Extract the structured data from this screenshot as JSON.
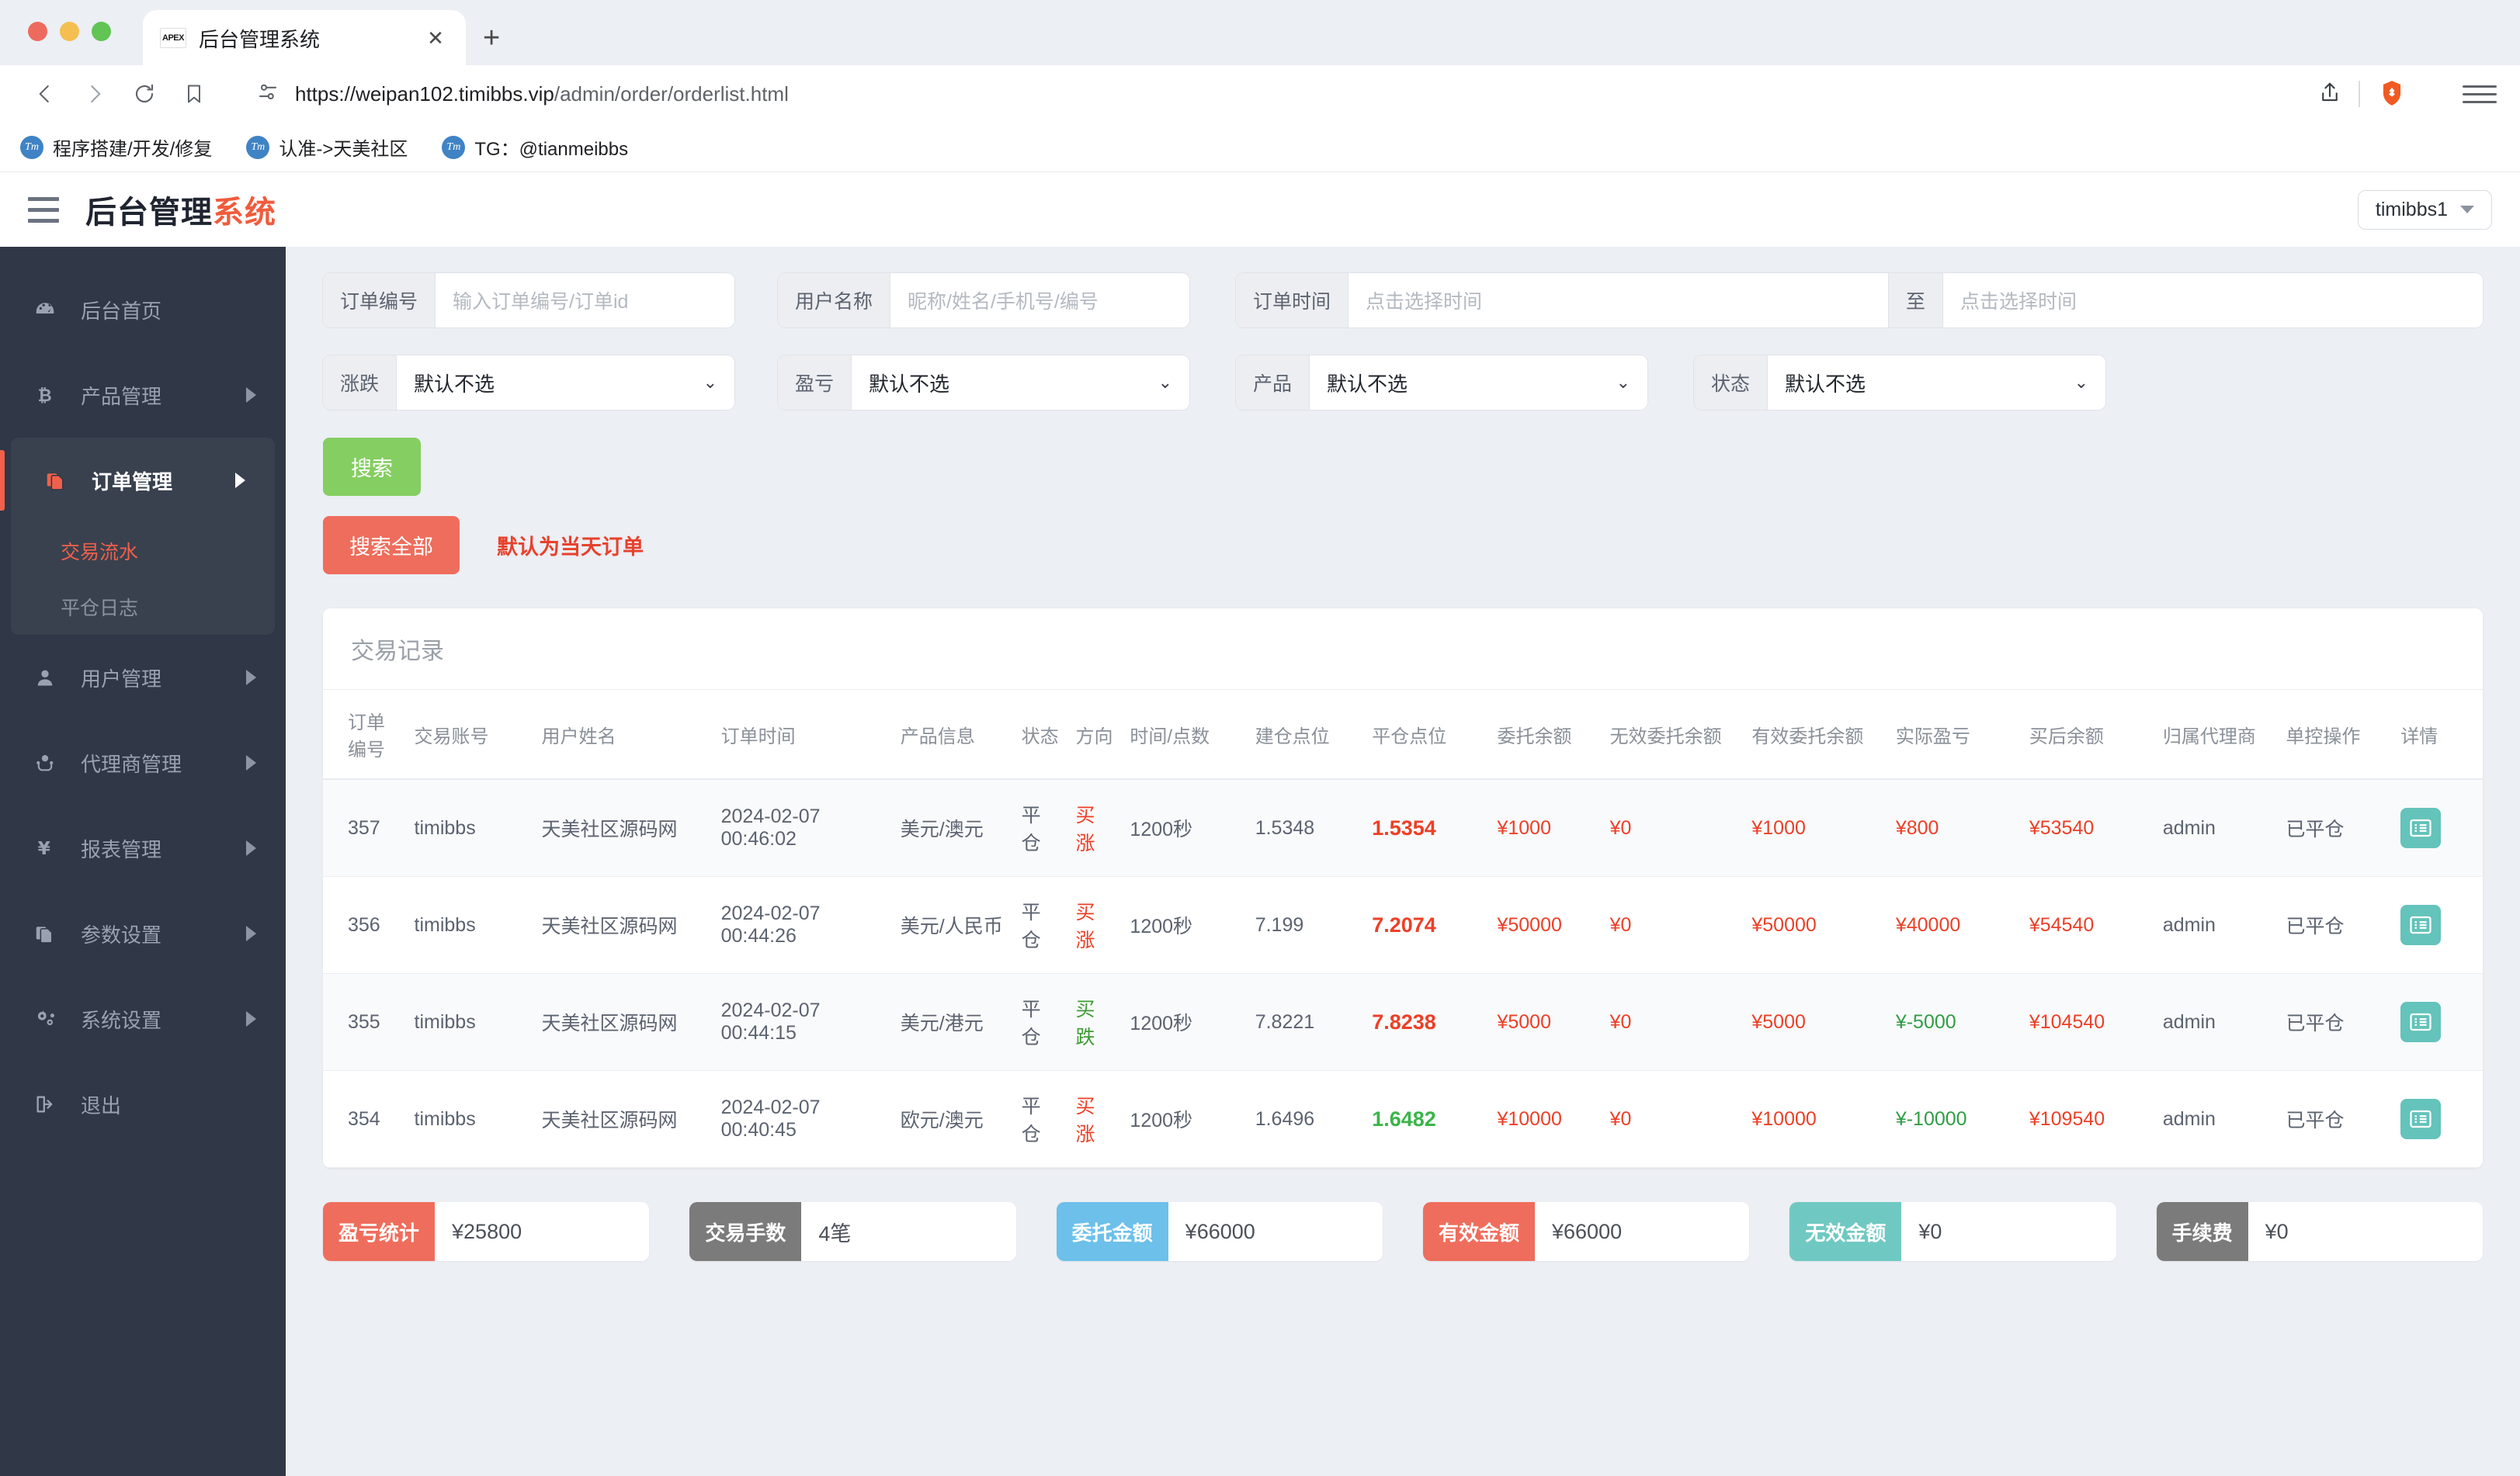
{
  "browser": {
    "tab_title": "后台管理系统",
    "tab_favicon_text": "APEX",
    "tab_close": "✕",
    "new_tab": "+",
    "url_secure": "https://weipan102.timibbs.vip",
    "url_path": "/admin/order/orderlist.html",
    "bookmarks": [
      {
        "icon": "Tm",
        "label": "程序搭建/开发/修复"
      },
      {
        "icon": "Tm",
        "label": "认准->天美社区"
      },
      {
        "icon": "Tm",
        "label": "TG：@tianmeibbs"
      }
    ]
  },
  "header": {
    "brand_main": "后台管理",
    "brand_accent": "系统",
    "user": "timibbs1"
  },
  "sidebar": {
    "items": [
      {
        "label": "后台首页",
        "icon": "dashboard-icon",
        "arrow": false
      },
      {
        "label": "产品管理",
        "icon": "bitcoin-icon",
        "arrow": true
      },
      {
        "label": "订单管理",
        "icon": "order-doc-icon",
        "arrow": true,
        "active": true,
        "children": [
          {
            "label": "交易流水",
            "selected": true
          },
          {
            "label": "平仓日志",
            "selected": false
          }
        ]
      },
      {
        "label": "用户管理",
        "icon": "user-icon",
        "arrow": true
      },
      {
        "label": "代理商管理",
        "icon": "agent-icon",
        "arrow": true
      },
      {
        "label": "报表管理",
        "icon": "yen-icon",
        "arrow": true
      },
      {
        "label": "参数设置",
        "icon": "params-doc-icon",
        "arrow": true
      },
      {
        "label": "系统设置",
        "icon": "gears-icon",
        "arrow": true
      },
      {
        "label": "退出",
        "icon": "logout-icon",
        "arrow": false
      }
    ]
  },
  "filters": {
    "order_no": {
      "label": "订单编号",
      "placeholder": "输入订单编号/订单id",
      "value": ""
    },
    "user_name": {
      "label": "用户名称",
      "placeholder": "昵称/姓名/手机号/编号",
      "value": ""
    },
    "order_time": {
      "label": "订单时间",
      "placeholder_from": "点击选择时间",
      "separator": "至",
      "placeholder_to": "点击选择时间"
    },
    "updown": {
      "label": "涨跌",
      "value": "默认不选"
    },
    "profit_loss": {
      "label": "盈亏",
      "value": "默认不选"
    },
    "product": {
      "label": "产品",
      "value": "默认不选"
    },
    "status": {
      "label": "状态",
      "value": "默认不选"
    },
    "search_button": "搜索",
    "search_all_button": "搜索全部",
    "note": "默认为当天订单"
  },
  "table": {
    "title": "交易记录",
    "columns": [
      "订单编号",
      "交易账号",
      "用户姓名",
      "订单时间",
      "产品信息",
      "状态",
      "方向",
      "时间/点数",
      "建仓点位",
      "平仓点位",
      "委托余额",
      "无效委托余额",
      "有效委托余额",
      "实际盈亏",
      "买后余额",
      "归属代理商",
      "单控操作",
      "详情"
    ],
    "rows": [
      {
        "order_no": "357",
        "account": "timibbs",
        "user_name": "天美社区源码网",
        "order_time": "2024-02-07 00:46:02",
        "product": "美元/澳元",
        "status": "平仓",
        "direction": "买涨",
        "direction_color": "red",
        "duration": "1200秒",
        "open_price": "1.5348",
        "close_price": "1.5354",
        "close_color": "red",
        "entrust": "¥1000",
        "invalid_entrust": "¥0",
        "valid_entrust": "¥1000",
        "real_pl": "¥800",
        "real_pl_color": "red",
        "balance_after": "¥53540",
        "agent": "admin",
        "single_control": "已平仓",
        "detail_icon": "detail-icon"
      },
      {
        "order_no": "356",
        "account": "timibbs",
        "user_name": "天美社区源码网",
        "order_time": "2024-02-07 00:44:26",
        "product": "美元/人民币",
        "status": "平仓",
        "direction": "买涨",
        "direction_color": "red",
        "duration": "1200秒",
        "open_price": "7.199",
        "close_price": "7.2074",
        "close_color": "red",
        "entrust": "¥50000",
        "invalid_entrust": "¥0",
        "valid_entrust": "¥50000",
        "real_pl": "¥40000",
        "real_pl_color": "red",
        "balance_after": "¥54540",
        "agent": "admin",
        "single_control": "已平仓",
        "detail_icon": "detail-icon"
      },
      {
        "order_no": "355",
        "account": "timibbs",
        "user_name": "天美社区源码网",
        "order_time": "2024-02-07 00:44:15",
        "product": "美元/港元",
        "status": "平仓",
        "direction": "买跌",
        "direction_color": "green",
        "duration": "1200秒",
        "open_price": "7.8221",
        "close_price": "7.8238",
        "close_color": "red",
        "entrust": "¥5000",
        "invalid_entrust": "¥0",
        "valid_entrust": "¥5000",
        "real_pl": "¥-5000",
        "real_pl_color": "green",
        "balance_after": "¥104540",
        "agent": "admin",
        "single_control": "已平仓",
        "detail_icon": "detail-icon"
      },
      {
        "order_no": "354",
        "account": "timibbs",
        "user_name": "天美社区源码网",
        "order_time": "2024-02-07 00:40:45",
        "product": "欧元/澳元",
        "status": "平仓",
        "direction": "买涨",
        "direction_color": "red",
        "duration": "1200秒",
        "open_price": "1.6496",
        "close_price": "1.6482",
        "close_color": "green",
        "entrust": "¥10000",
        "invalid_entrust": "¥0",
        "valid_entrust": "¥10000",
        "real_pl": "¥-10000",
        "real_pl_color": "green",
        "balance_after": "¥109540",
        "agent": "admin",
        "single_control": "已平仓",
        "detail_icon": "detail-icon"
      }
    ]
  },
  "stats": [
    {
      "label": "盈亏统计",
      "value": "¥25800",
      "color": "#ef6d5c"
    },
    {
      "label": "交易手数",
      "value": "4笔",
      "color": "#7b7b7b"
    },
    {
      "label": "委托金额",
      "value": "¥66000",
      "color": "#6cc0ea"
    },
    {
      "label": "有效金额",
      "value": "¥66000",
      "color": "#ef6d5c"
    },
    {
      "label": "无效金额",
      "value": "¥0",
      "color": "#6fc9c2"
    },
    {
      "label": "手续费",
      "value": "¥0",
      "color": "#7b7b7b"
    }
  ]
}
